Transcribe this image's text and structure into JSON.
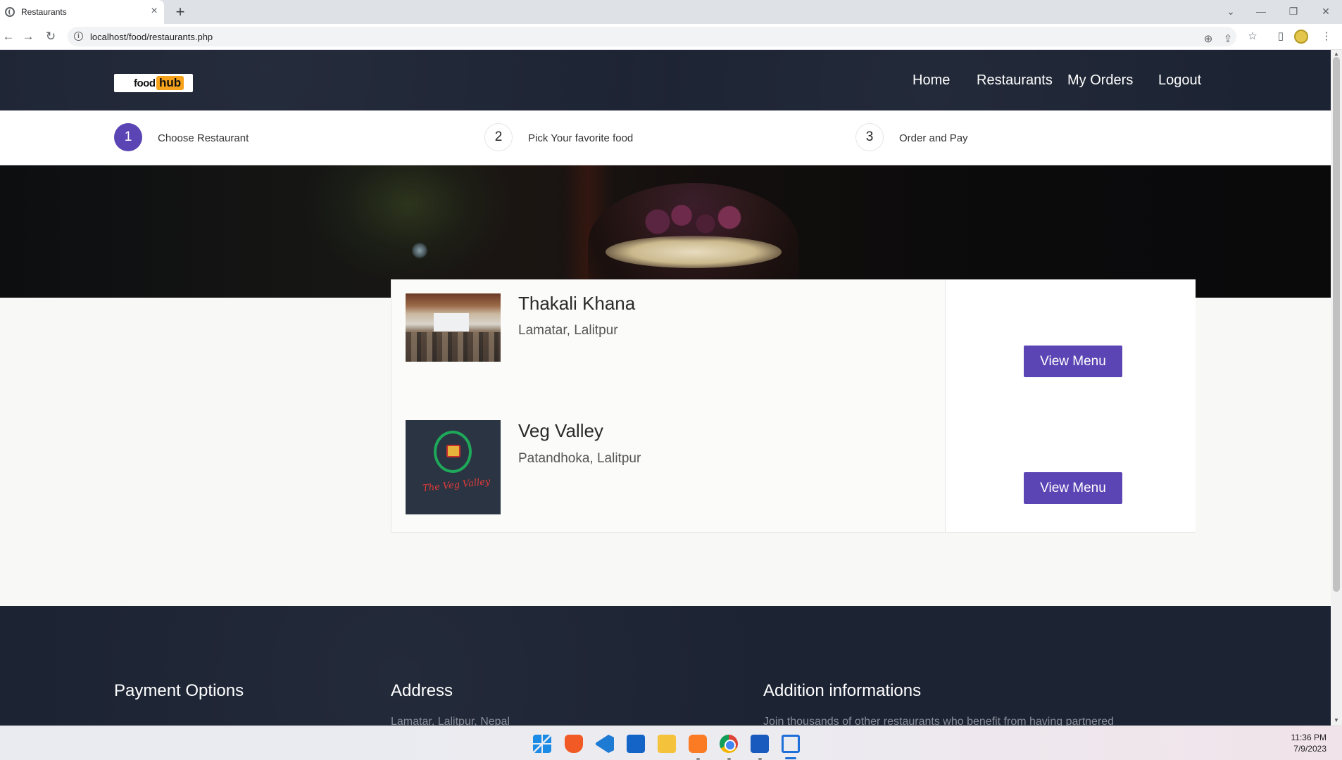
{
  "browser": {
    "tab_title": "Restaurants",
    "tab_close": "×",
    "new_tab": "+",
    "url": "localhost/food/restaurants.php",
    "win_controls": {
      "dropdown": "⌄",
      "minimize": "—",
      "restore": "❐",
      "close": "✕"
    },
    "icons": {
      "back": "←",
      "forward": "→",
      "reload": "↻",
      "zoom": "⊕",
      "share": "⇪",
      "star": "☆",
      "sidebar": "▯",
      "menu": "⋮"
    }
  },
  "header": {
    "logo": {
      "food": "food",
      "hub": "hub"
    },
    "nav": [
      "Home",
      "Restaurants",
      "My Orders",
      "Logout"
    ]
  },
  "steps": [
    {
      "num": "1",
      "label": "Choose Restaurant"
    },
    {
      "num": "2",
      "label": "Pick Your favorite food"
    },
    {
      "num": "3",
      "label": "Order and Pay"
    }
  ],
  "restaurants": [
    {
      "name": "Thakali Khana",
      "location": "Lamatar, Lalitpur",
      "button": "View Menu"
    },
    {
      "name": "Veg Valley",
      "location": "Patandhoka, Lalitpur",
      "button": "View Menu",
      "logo_text": "The Veg Valley"
    }
  ],
  "footer": {
    "headings": [
      "Payment Options",
      "Address",
      "Addition informations"
    ],
    "partial_text": [
      "Lamatar, Lalitpur, Nepal",
      "Join thousands of other restaurants who benefit from having partnered"
    ]
  },
  "taskbar": {
    "time": "11:36 PM",
    "date": "7/9/2023"
  },
  "colors": {
    "header_bg": "#1c2333",
    "accent": "#5b45b4",
    "logo_hub": "#f7a21b"
  }
}
